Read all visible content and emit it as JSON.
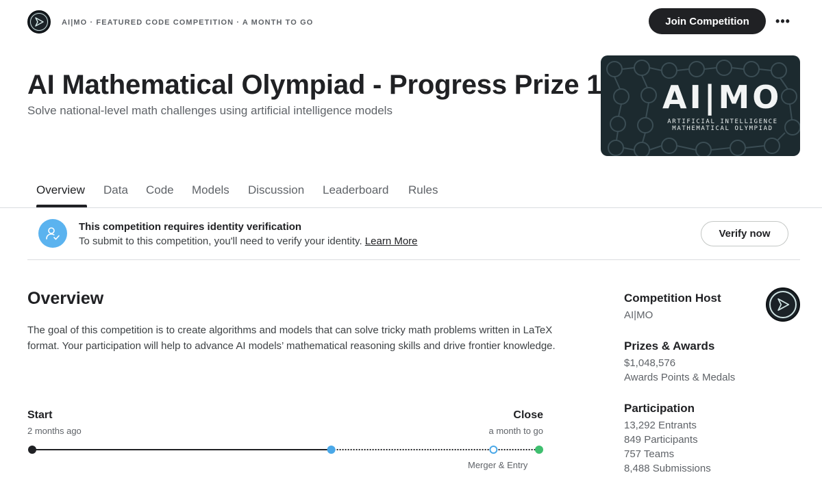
{
  "header": {
    "meta": "AI|MO · FEATURED CODE COMPETITION · A MONTH TO GO",
    "join_label": "Join Competition",
    "more_label": "•••"
  },
  "competition": {
    "title": "AI Mathematical Olympiad - Progress Prize 1",
    "subtitle": "Solve national-level math challenges using artificial intelligence models",
    "banner_logo": "AI|MO",
    "banner_sub_line1": "ARTIFICIAL INTELLIGENCE",
    "banner_sub_line2": "MATHEMATICAL OLYMPIAD"
  },
  "tabs": [
    {
      "label": "Overview"
    },
    {
      "label": "Data"
    },
    {
      "label": "Code"
    },
    {
      "label": "Models"
    },
    {
      "label": "Discussion"
    },
    {
      "label": "Leaderboard"
    },
    {
      "label": "Rules"
    }
  ],
  "verify": {
    "title": "This competition requires identity verification",
    "text": "To submit to this competition, you'll need to verify your identity.",
    "link": "Learn More",
    "button": "Verify now"
  },
  "overview": {
    "heading": "Overview",
    "text": "The goal of this competition is to create algorithms and models that can solve tricky math problems written in LaTeX format. Your participation will help to advance AI models’ mathematical reasoning skills and drive frontier knowledge."
  },
  "timeline": {
    "start_label": "Start",
    "start_sub": "2 months ago",
    "close_label": "Close",
    "close_sub": "a month to go",
    "merger_label": "Merger & Entry",
    "progress": 0.59,
    "merger_position": 0.91,
    "colors": {
      "start": "#202124",
      "current": "#4aa8e8",
      "merger": "#4aa8e8",
      "close": "#3fbf6f"
    }
  },
  "sidebar": {
    "host_heading": "Competition Host",
    "host_name": "AI|MO",
    "prizes_heading": "Prizes & Awards",
    "prize_amount": "$1,048,576",
    "prize_extra": "Awards Points & Medals",
    "participation_heading": "Participation",
    "entrants": "13,292 Entrants",
    "participants": "849 Participants",
    "teams": "757 Teams",
    "submissions": "8,488 Submissions"
  }
}
